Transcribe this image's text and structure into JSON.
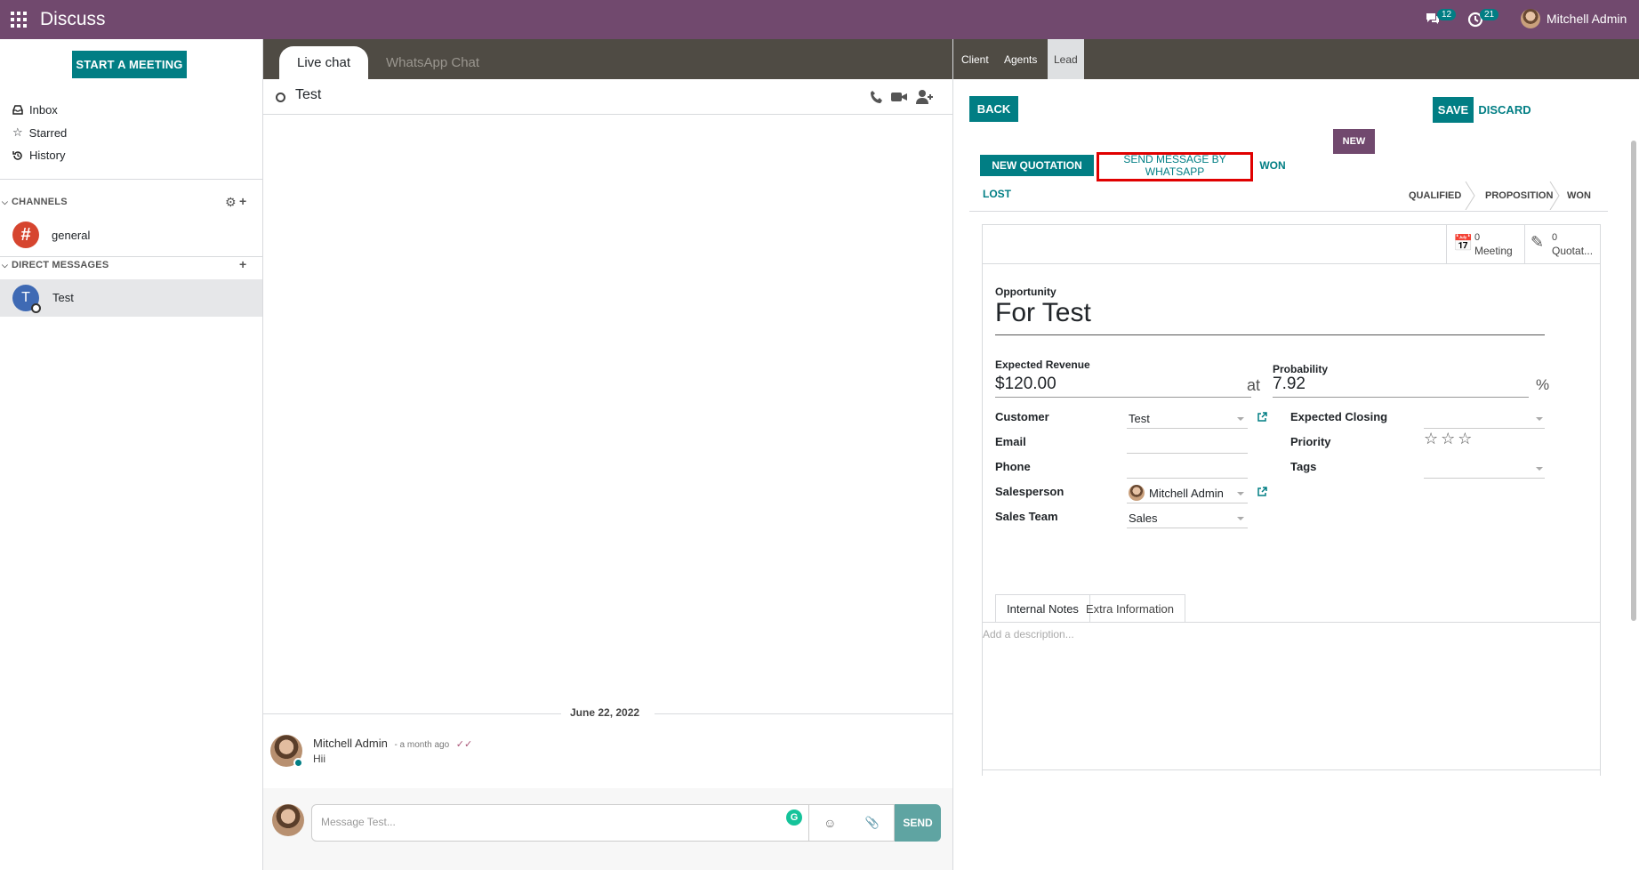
{
  "topbar": {
    "app_title": "Discuss",
    "messages_count": "12",
    "activities_count": "21",
    "user_name": "Mitchell Admin"
  },
  "sidebar": {
    "start_meeting": "START A MEETING",
    "nav": [
      {
        "label": "Inbox",
        "icon": "inbox-icon"
      },
      {
        "label": "Starred",
        "icon": "star-icon"
      },
      {
        "label": "History",
        "icon": "history-icon"
      }
    ],
    "channels_header": "CHANNELS",
    "channels": [
      {
        "label": "general",
        "glyph": "#"
      }
    ],
    "dm_header": "DIRECT MESSAGES",
    "dms": [
      {
        "label": "Test",
        "initial": "T"
      }
    ]
  },
  "chat": {
    "tabs": [
      "Live chat",
      "WhatsApp Chat"
    ],
    "thread_name": "Test",
    "date_separator": "June 22, 2022",
    "message": {
      "author": "Mitchell Admin",
      "time": "- a month ago",
      "body": "Hii"
    },
    "composer": {
      "placeholder": "Message Test...",
      "send": "SEND",
      "grammarly": "G"
    }
  },
  "form": {
    "tabs": [
      "Client",
      "Agents",
      "Lead"
    ],
    "back": "BACK",
    "save": "SAVE",
    "discard": "DISCARD",
    "actions": {
      "new_quotation": "NEW QUOTATION",
      "send_whatsapp": "SEND MESSAGE BY WHATSAPP",
      "won": "WON",
      "lost": "LOST"
    },
    "status_new": "NEW",
    "stages": [
      "QUALIFIED",
      "PROPOSITION",
      "WON"
    ],
    "smart_buttons": [
      {
        "count": "0",
        "label": "Meeting"
      },
      {
        "count": "0",
        "label": "Quotat..."
      }
    ],
    "opportunity_label": "Opportunity",
    "opportunity_name": "For Test",
    "expected_revenue_label": "Expected Revenue",
    "expected_revenue": "$120.00",
    "at": "at",
    "probability_label": "Probability",
    "probability": "7.92",
    "percent": "%",
    "left_fields": [
      {
        "label": "Customer",
        "value": "Test"
      },
      {
        "label": "Email",
        "value": ""
      },
      {
        "label": "Phone",
        "value": ""
      },
      {
        "label": "Salesperson",
        "value": "Mitchell Admin"
      },
      {
        "label": "Sales Team",
        "value": "Sales"
      }
    ],
    "right_fields": [
      {
        "label": "Expected Closing",
        "value": ""
      },
      {
        "label": "Priority",
        "value": ""
      },
      {
        "label": "Tags",
        "value": ""
      }
    ],
    "priority_stars": 0,
    "notes_tabs": [
      "Internal Notes",
      "Extra Information"
    ],
    "description_placeholder": "Add a description..."
  },
  "colors": {
    "brand": "#71496e",
    "accent": "#017e84",
    "highlight": "#e00000"
  }
}
